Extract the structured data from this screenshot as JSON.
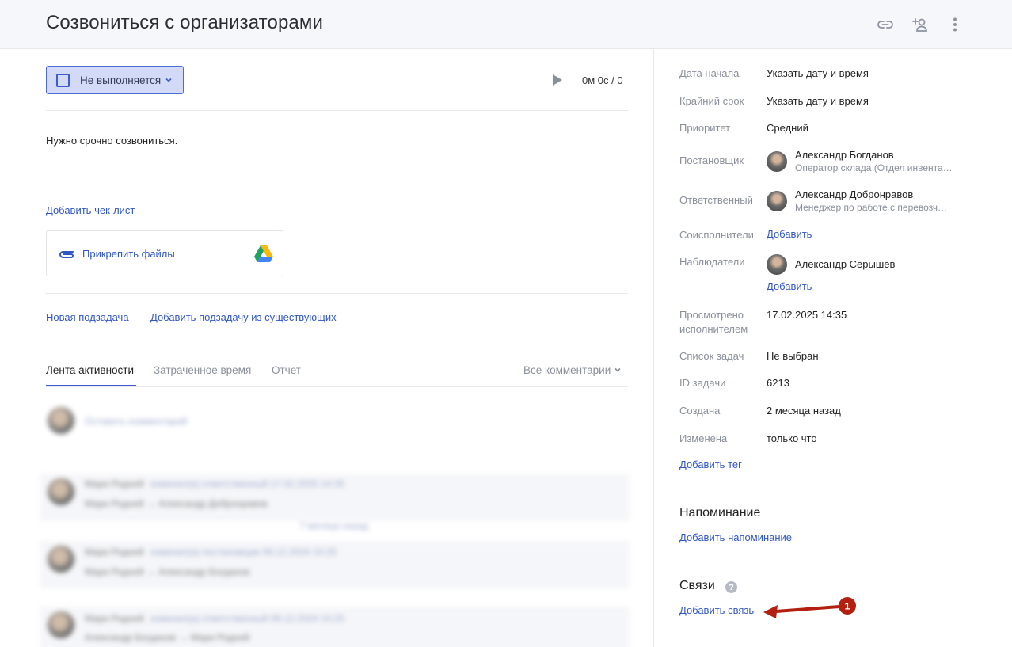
{
  "header": {
    "title": "Созвониться с организаторами",
    "icons": [
      "link-icon",
      "add-user-icon",
      "more-vertical-icon"
    ]
  },
  "task": {
    "status_label": "Не выполняется",
    "timer": "0м 0с / 0",
    "description": "Нужно срочно созвониться.",
    "add_checklist": "Добавить чек-лист",
    "attach_files": "Прикрепить файлы",
    "new_subtask": "Новая подзадача",
    "add_subtask_existing": "Добавить подзадачу из существующих"
  },
  "tabs": {
    "activity": "Лента активности",
    "time_spent": "Затраченное время",
    "report": "Отчет",
    "all_comments": "Все комментарии"
  },
  "feed": {
    "comment_placeholder": "Оставить комментарий",
    "items": [
      {
        "author": "Мари Родней",
        "action": "изменил(а) ответственный 17.02.2025 14:35",
        "detail": "Мари Родней → Александр Добронравов"
      },
      {
        "separator": "7 месяца назад"
      },
      {
        "author": "Мари Родней",
        "action": "изменил(а) постановщик 09.12.2024 10:25",
        "detail": "Мари Родней → Александр Богданов"
      },
      {
        "author": "Мари Родней",
        "action": "изменил(а) ответственный 09.12.2024 10:25",
        "detail": "Александр Богданов → Мари Родней"
      }
    ]
  },
  "props": {
    "start_date_label": "Дата начала",
    "start_date_value": "Указать дату и время",
    "deadline_label": "Крайний срок",
    "deadline_value": "Указать дату и время",
    "priority_label": "Приоритет",
    "priority_value": "Средний",
    "creator_label": "Постановщик",
    "creator_name": "Александр Богданов",
    "creator_role": "Оператор склада (Отдел инвента…",
    "assignee_label": "Ответственный",
    "assignee_name": "Александр Добронравов",
    "assignee_role": "Менеджер по работе с перевозч…",
    "coexecutors_label": "Соисполнители",
    "coexecutors_add": "Добавить",
    "watchers_label": "Наблюдатели",
    "watcher_name": "Александр Серышев",
    "watchers_add": "Добавить",
    "viewed_label_1": "Просмотрено",
    "viewed_label_2": "исполнителем",
    "viewed_value": "17.02.2025 14:35",
    "tasklist_label": "Список задач",
    "tasklist_value": "Не выбран",
    "task_id_label": "ID задачи",
    "task_id_value": "6213",
    "created_label": "Создана",
    "created_value": "2 месяца назад",
    "modified_label": "Изменена",
    "modified_value": "только что",
    "add_tag": "Добавить тег"
  },
  "reminder": {
    "title": "Напоминание",
    "add": "Добавить напоминание"
  },
  "links": {
    "title": "Связи",
    "help": "?",
    "add": "Добавить связь"
  },
  "annotation": {
    "badge": "1",
    "color": "#b3200f"
  },
  "colors": {
    "accent": "#3f5bd0",
    "link": "#2f56c9",
    "status_bg": "#d2daf7",
    "muted": "#8a8f9c"
  }
}
